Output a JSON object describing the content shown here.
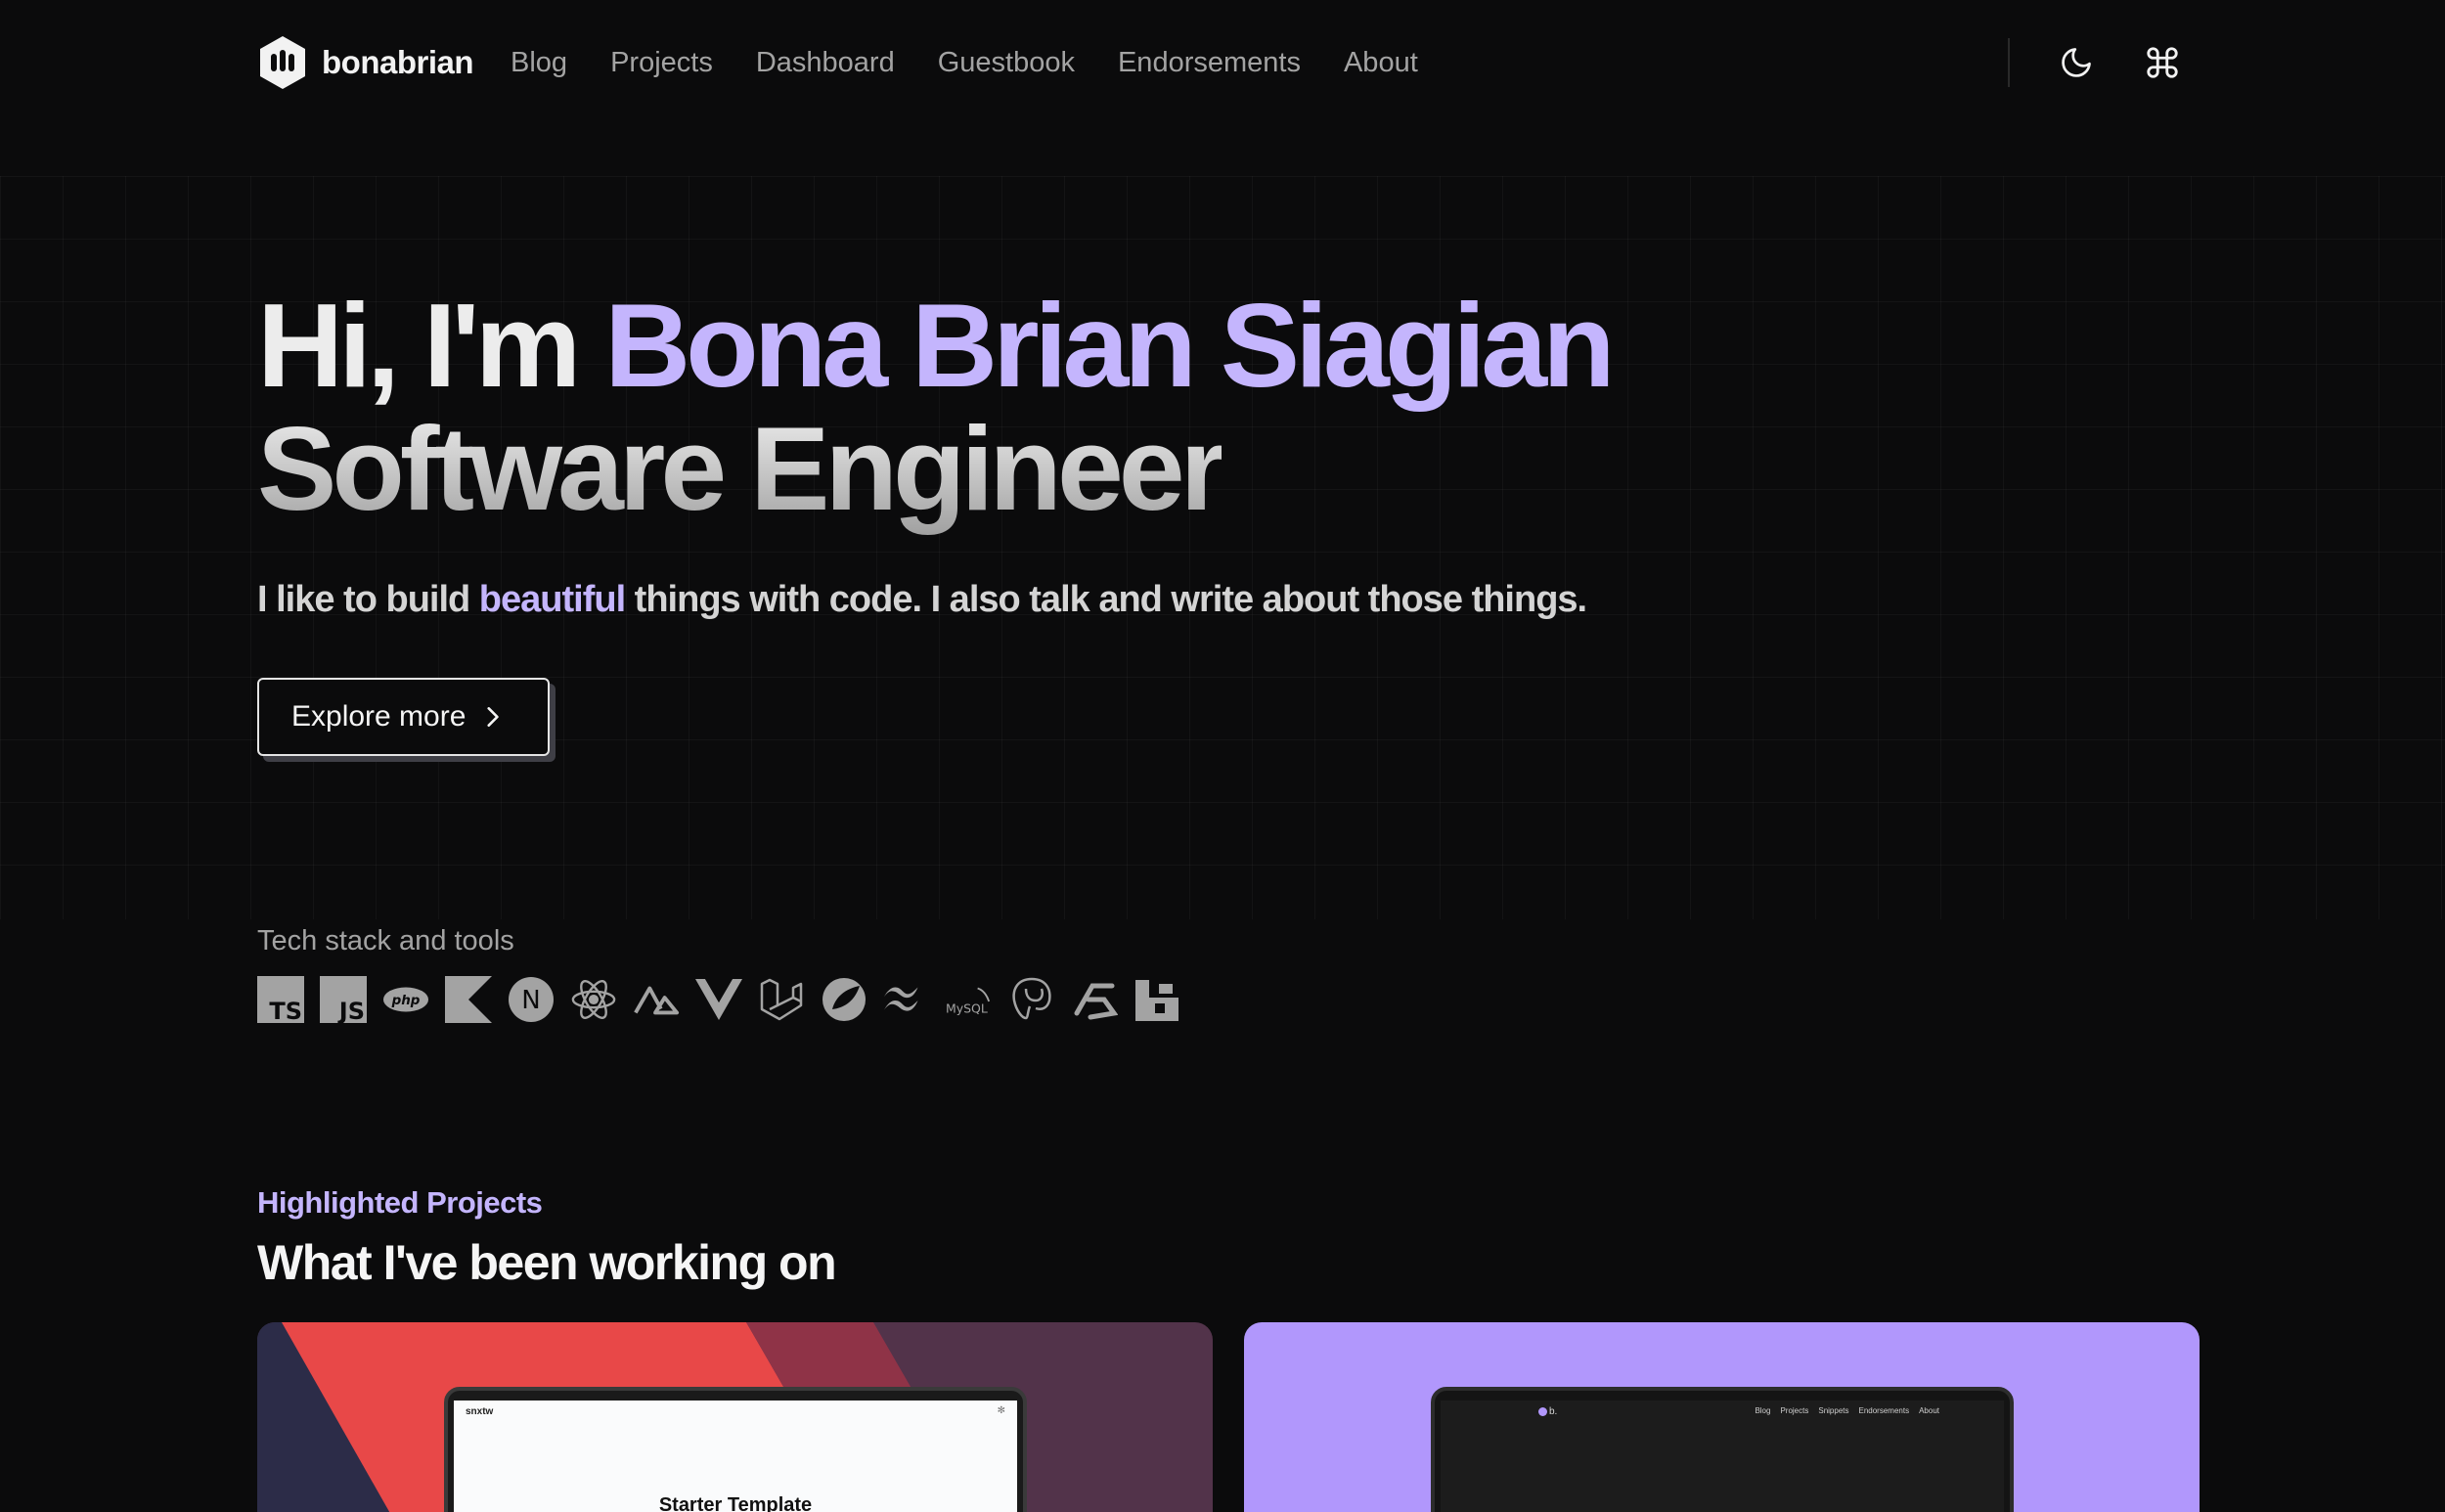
{
  "nav": {
    "logo_text": "bonabrian",
    "links": [
      "Blog",
      "Projects",
      "Dashboard",
      "Guestbook",
      "Endorsements",
      "About"
    ]
  },
  "hero": {
    "greeting": "Hi, I'm ",
    "name": "Bona Brian Siagian",
    "role": "Software Engineer",
    "sub_before": "I like to build ",
    "sub_accent": "beautiful",
    "sub_after": " things with code. I also talk and write about those things.",
    "cta_label": "Explore more"
  },
  "tech": {
    "label": "Tech stack and tools",
    "icons": [
      "typescript-icon",
      "javascript-icon",
      "php-icon",
      "kotlin-icon",
      "nextjs-icon",
      "react-icon",
      "nuxt-icon",
      "vue-icon",
      "laravel-icon",
      "spring-icon",
      "tailwind-icon",
      "mysql-icon",
      "postgresql-icon",
      "prisma-icon",
      "bitbucket-icon"
    ],
    "ts_text": "TS",
    "js_text": "JS",
    "php_text": "php",
    "next_text": "N",
    "mysql_text": "MySQL"
  },
  "projects": {
    "eyebrow": "Highlighted Projects",
    "heading": "What I've been working on",
    "card1": {
      "mini_logo": "snxtw",
      "mini_star": "✻",
      "screen_title": "Starter Template"
    },
    "card2": {
      "mini_brand": "b.",
      "mini_nav": [
        "Blog",
        "Projects",
        "Snippets",
        "Endorsements",
        "About"
      ]
    }
  },
  "colors": {
    "background": "#0b0b0c",
    "accent": "#c4b5fd",
    "card2_bg": "#b197fc"
  }
}
